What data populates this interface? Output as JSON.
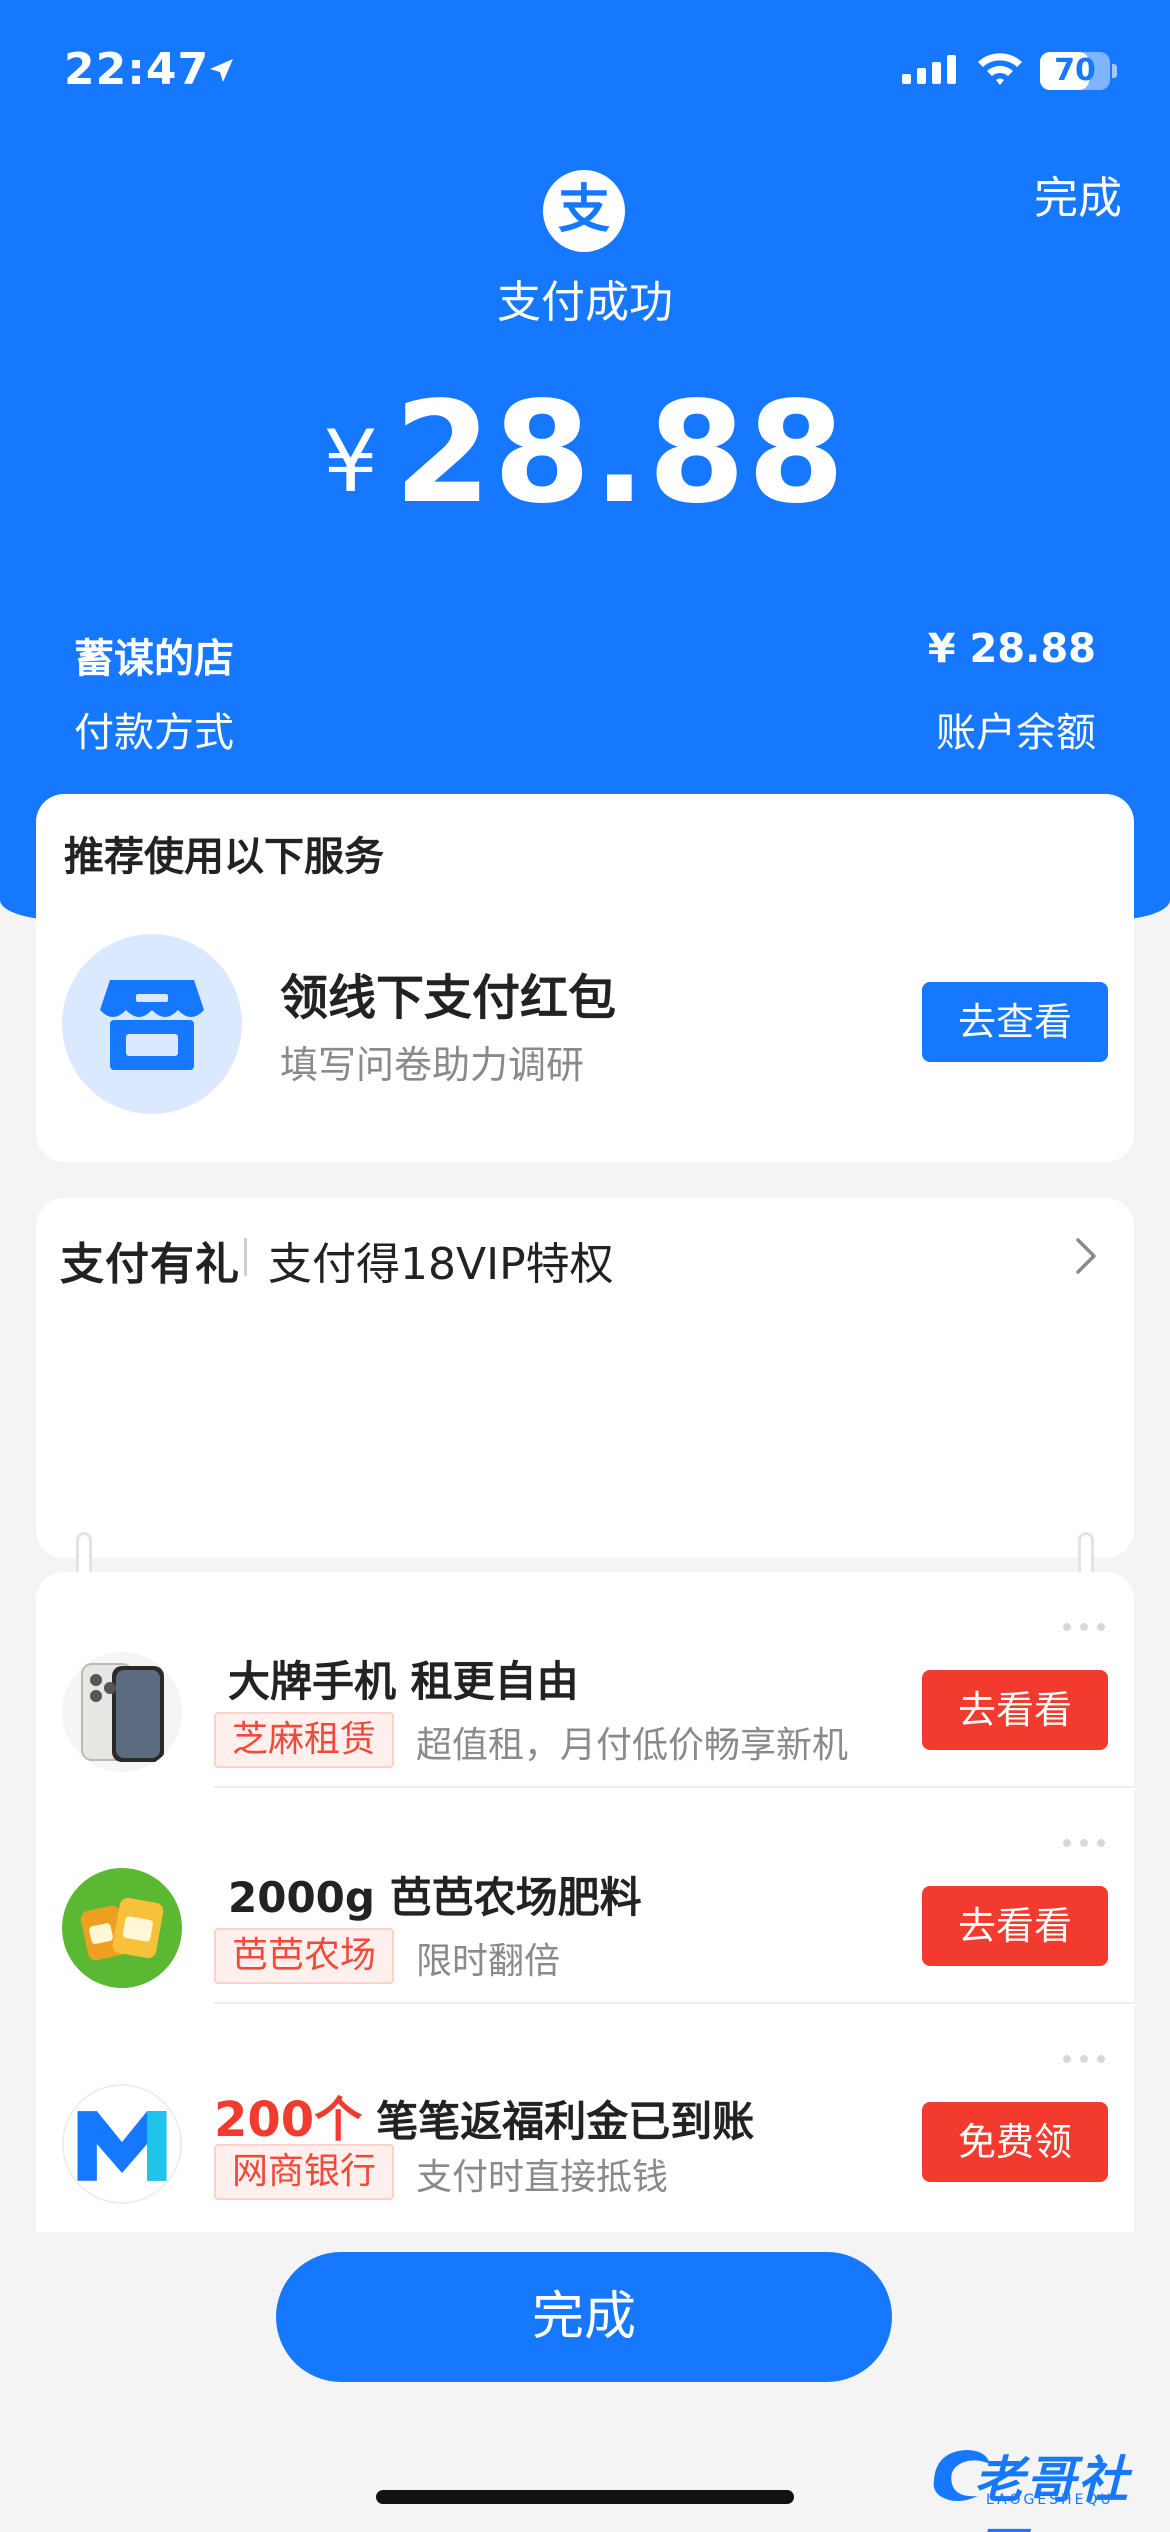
{
  "status_bar": {
    "time": "22:47",
    "battery_text": "70",
    "battery_level": 0.7
  },
  "header": {
    "done_label": "完成",
    "brand_glyph": "支",
    "title": "支付成功",
    "currency_symbol": "¥",
    "amount": "28.88"
  },
  "details": {
    "merchant": "蓄谋的店",
    "merchant_amount": "¥ 28.88",
    "payment_method_label": "付款方式",
    "payment_method_value": "账户余额"
  },
  "recommend": {
    "heading": "推荐使用以下服务",
    "title": "领线下支付红包",
    "subtitle": "填写问卷助力调研",
    "button": "去查看"
  },
  "gift": {
    "brand": "支付有礼",
    "title": "支付得18VIP特权"
  },
  "offers": [
    {
      "title": "大牌手机 租更自由",
      "highlight": "",
      "tag": "芝麻租赁",
      "desc": "超值租，月付低价畅享新机",
      "button": "去看看",
      "icon": "phone-icon"
    },
    {
      "title": "2000g 芭芭农场肥料",
      "highlight": "",
      "tag": "芭芭农场",
      "desc": "限时翻倍",
      "button": "去看看",
      "icon": "fertilizer-icon"
    },
    {
      "title": "笔笔返福利金已到账",
      "highlight": "200个",
      "tag": "网商银行",
      "desc": "支付时直接抵钱",
      "button": "免费领",
      "icon": "mybank-icon"
    }
  ],
  "footer": {
    "done_button": "完成"
  },
  "watermark": {
    "text": "老哥社区",
    "sub": "LAOGESHEQU"
  },
  "colors": {
    "brand_blue": "#1677ff",
    "accent_red": "#f23a2e"
  }
}
